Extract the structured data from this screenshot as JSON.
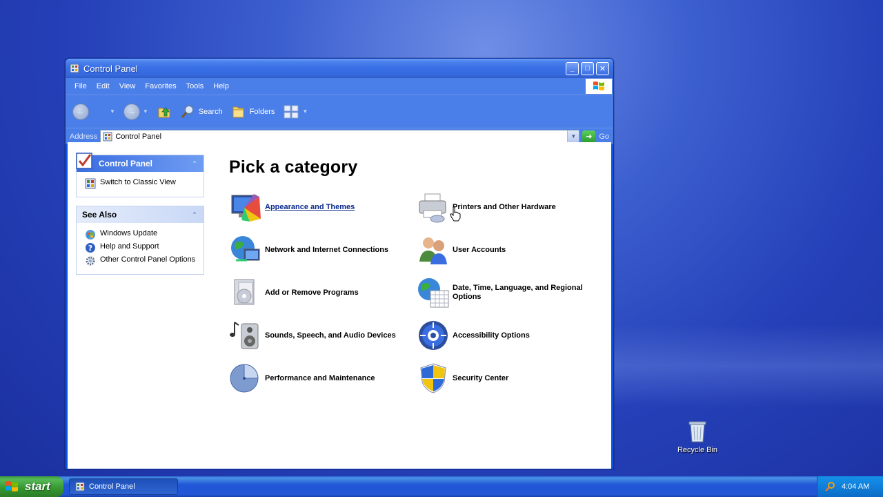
{
  "window": {
    "title": "Control Panel",
    "menu": [
      "File",
      "Edit",
      "View",
      "Favorites",
      "Tools",
      "Help"
    ],
    "toolbar": {
      "search": "Search",
      "folders": "Folders"
    },
    "address": {
      "label": "Address",
      "value": "Control Panel",
      "go": "Go"
    }
  },
  "sidebar": {
    "control_panel": {
      "title": "Control Panel",
      "link": "Switch to Classic View"
    },
    "see_also": {
      "title": "See Also",
      "links": [
        "Windows Update",
        "Help and Support",
        "Other Control Panel Options"
      ]
    }
  },
  "main": {
    "heading": "Pick a category",
    "categories": [
      {
        "label": "Appearance and Themes",
        "icon": "appearance-icon"
      },
      {
        "label": "Printers and Other Hardware",
        "icon": "printer-icon"
      },
      {
        "label": "Network and Internet Connections",
        "icon": "network-icon"
      },
      {
        "label": "User Accounts",
        "icon": "users-icon"
      },
      {
        "label": "Add or Remove Programs",
        "icon": "add-remove-icon"
      },
      {
        "label": "Date, Time, Language, and Regional Options",
        "icon": "globe-calendar-icon"
      },
      {
        "label": "Sounds, Speech, and Audio Devices",
        "icon": "speaker-icon"
      },
      {
        "label": "Accessibility Options",
        "icon": "accessibility-icon"
      },
      {
        "label": "Performance and Maintenance",
        "icon": "performance-icon"
      },
      {
        "label": "Security Center",
        "icon": "shield-icon"
      }
    ]
  },
  "desktop": {
    "recycle_bin": "Recycle Bin"
  },
  "taskbar": {
    "start": "start",
    "task": "Control Panel",
    "clock": "4:04 AM"
  }
}
